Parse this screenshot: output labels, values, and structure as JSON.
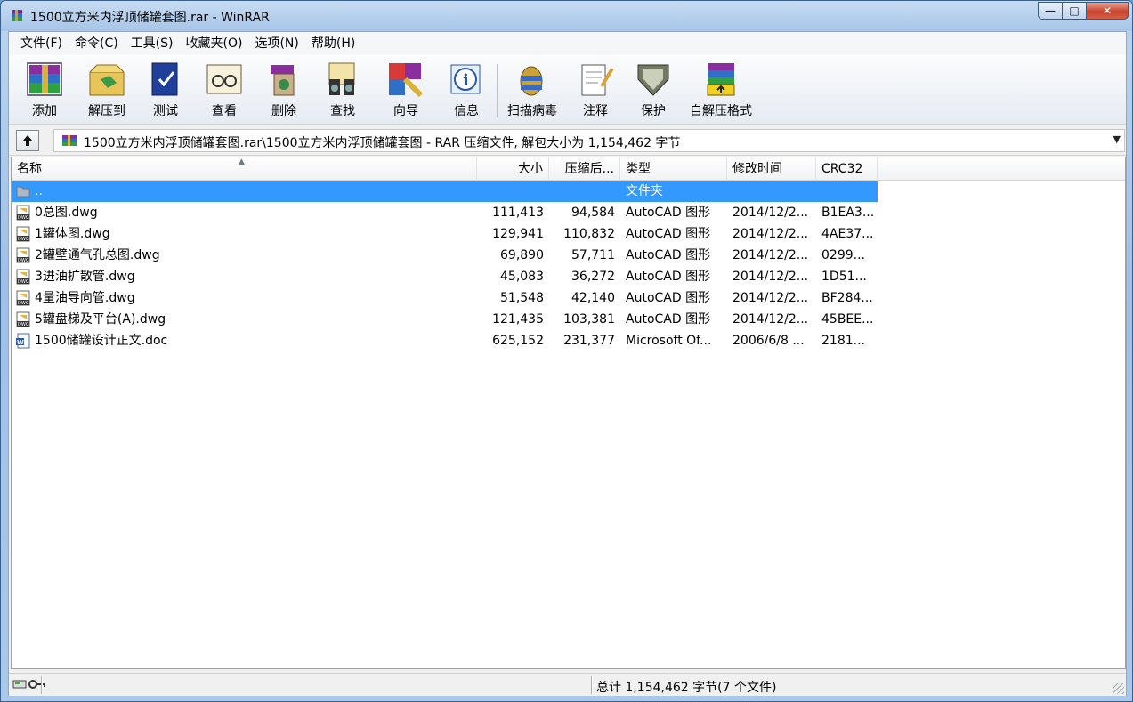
{
  "window": {
    "title": "1500立方米内浮顶储罐套图.rar - WinRAR"
  },
  "menu": [
    {
      "label": "文件(F)"
    },
    {
      "label": "命令(C)"
    },
    {
      "label": "工具(S)"
    },
    {
      "label": "收藏夹(O)"
    },
    {
      "label": "选项(N)"
    },
    {
      "label": "帮助(H)"
    }
  ],
  "toolbar": [
    {
      "label": "添加",
      "icon": "add-archive-icon"
    },
    {
      "label": "解压到",
      "icon": "extract-to-icon"
    },
    {
      "label": "测试",
      "icon": "test-icon"
    },
    {
      "label": "查看",
      "icon": "view-icon"
    },
    {
      "label": "删除",
      "icon": "delete-icon"
    },
    {
      "label": "查找",
      "icon": "find-icon"
    },
    {
      "label": "向导",
      "icon": "wizard-icon"
    },
    {
      "label": "信息",
      "icon": "info-icon"
    },
    {
      "label": "扫描病毒",
      "icon": "virus-scan-icon"
    },
    {
      "label": "注释",
      "icon": "comment-icon"
    },
    {
      "label": "保护",
      "icon": "protect-icon"
    },
    {
      "label": "自解压格式",
      "icon": "sfx-icon"
    }
  ],
  "address": {
    "path": "1500立方米内浮顶储罐套图.rar\\1500立方米内浮顶储罐套图 - RAR 压缩文件, 解包大小为 1,154,462 字节"
  },
  "columns": {
    "name": "名称",
    "size": "大小",
    "packed": "压缩后...",
    "type": "类型",
    "modified": "修改时间",
    "crc": "CRC32"
  },
  "files": [
    {
      "name": "..",
      "size": "",
      "packed": "",
      "type": "文件夹",
      "modified": "",
      "crc": "",
      "icon": "folder-icon",
      "selected": true
    },
    {
      "name": "0总图.dwg",
      "size": "111,413",
      "packed": "94,584",
      "type": "AutoCAD 图形",
      "modified": "2014/12/2...",
      "crc": "B1EA3...",
      "icon": "dwg-file-icon"
    },
    {
      "name": "1罐体图.dwg",
      "size": "129,941",
      "packed": "110,832",
      "type": "AutoCAD 图形",
      "modified": "2014/12/2...",
      "crc": "4AE37...",
      "icon": "dwg-file-icon"
    },
    {
      "name": "2罐壁通气孔总图.dwg",
      "size": "69,890",
      "packed": "57,711",
      "type": "AutoCAD 图形",
      "modified": "2014/12/2...",
      "crc": "0299...",
      "icon": "dwg-file-icon"
    },
    {
      "name": "3进油扩散管.dwg",
      "size": "45,083",
      "packed": "36,272",
      "type": "AutoCAD 图形",
      "modified": "2014/12/2...",
      "crc": "1D51...",
      "icon": "dwg-file-icon"
    },
    {
      "name": "4量油导向管.dwg",
      "size": "51,548",
      "packed": "42,140",
      "type": "AutoCAD 图形",
      "modified": "2014/12/2...",
      "crc": "BF284...",
      "icon": "dwg-file-icon"
    },
    {
      "name": "5罐盘梯及平台(A).dwg",
      "size": "121,435",
      "packed": "103,381",
      "type": "AutoCAD 图形",
      "modified": "2014/12/2...",
      "crc": "45BEE...",
      "icon": "dwg-file-icon"
    },
    {
      "name": "1500储罐设计正文.doc",
      "size": "625,152",
      "packed": "231,377",
      "type": "Microsoft Of...",
      "modified": "2006/6/8 ...",
      "crc": "2181...",
      "icon": "doc-file-icon"
    }
  ],
  "status": {
    "text": "总计 1,154,462 字节(7 个文件)"
  }
}
